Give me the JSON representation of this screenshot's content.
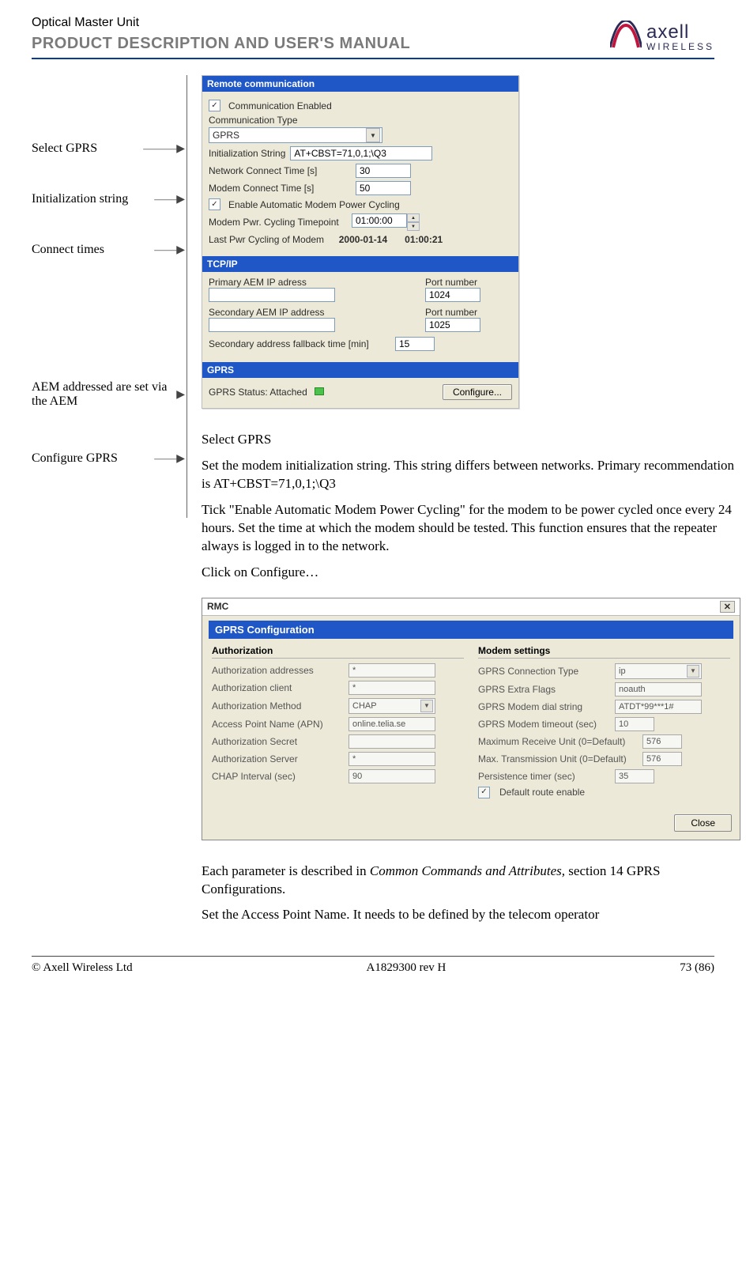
{
  "header": {
    "product": "Optical Master Unit",
    "manual_title": "PRODUCT DESCRIPTION AND USER'S MANUAL",
    "logo_text": "axell",
    "logo_sub": "WIRELESS"
  },
  "callouts": {
    "select_gprs": "Select GPRS",
    "init_string": "Initialization string",
    "connect_times": "Connect times",
    "aem_addresses": "AEM addressed are set via the AEM",
    "configure_gprs": "Configure GPRS"
  },
  "remote": {
    "section_title": "Remote communication",
    "comm_enabled_label": "Communication Enabled",
    "comm_enabled_checked": "✓",
    "comm_type_label": "Communication Type",
    "comm_type_value": "GPRS",
    "init_string_label": "Initialization String",
    "init_string_value": "AT+CBST=71,0,1;\\Q3",
    "net_connect_label": "Network Connect Time [s]",
    "net_connect_value": "30",
    "modem_connect_label": "Modem Connect Time [s]",
    "modem_connect_value": "50",
    "auto_cycle_label": "Enable Automatic Modem Power Cycling",
    "auto_cycle_checked": "✓",
    "cycle_time_label": "Modem Pwr. Cycling Timepoint",
    "cycle_time_value": "01:00:00",
    "last_cycle_label": "Last Pwr Cycling of Modem",
    "last_cycle_date": "2000-01-14",
    "last_cycle_time": "01:00:21"
  },
  "tcpip": {
    "section_title": "TCP/IP",
    "primary_ip_label": "Primary AEM IP adress",
    "primary_port_label": "Port number",
    "primary_port_value": "1024",
    "secondary_ip_label": "Secondary AEM IP address",
    "secondary_port_label": "Port number",
    "secondary_port_value": "1025",
    "fallback_label": "Secondary address fallback time [min]",
    "fallback_value": "15"
  },
  "gprs_bar": {
    "section_title": "GPRS",
    "status_label": "GPRS Status: ",
    "status_value": "Attached",
    "configure_btn": "Configure..."
  },
  "body": {
    "p1": "Select GPRS",
    "p2": "Set the modem initialization string. This string differs between networks. Primary recommendation is AT+CBST=71,0,1;\\Q3",
    "p3": "Tick \"Enable Automatic Modem Power Cycling\" for the modem to be power cycled once every 24 hours. Set the time at which the modem should be tested. This function ensures that the repeater always is logged in to the network.",
    "p4": "Click on Configure…",
    "p5a": "Each parameter is described in ",
    "p5i": "Common Commands and Attributes,",
    "p5b": " section 14 GPRS Configurations.",
    "p6": "Set the Access Point Name. It needs to be defined by the telecom operator"
  },
  "rmc": {
    "window_title": "RMC",
    "panel_title": "GPRS Configuration",
    "auth_head": "Authorization",
    "modem_head": "Modem settings",
    "auth": {
      "addresses_label": "Authorization addresses",
      "addresses_value": "*",
      "client_label": "Authorization client",
      "client_value": "*",
      "method_label": "Authorization Method",
      "method_value": "CHAP",
      "apn_label": "Access Point Name (APN)",
      "apn_value": "online.telia.se",
      "secret_label": "Authorization Secret",
      "secret_value": "",
      "server_label": "Authorization Server",
      "server_value": "*",
      "chap_label": "CHAP Interval (sec)",
      "chap_value": "90"
    },
    "modem": {
      "conn_type_label": "GPRS Connection Type",
      "conn_type_value": "ip",
      "extra_flags_label": "GPRS Extra Flags",
      "extra_flags_value": "noauth",
      "dial_label": "GPRS Modem dial string",
      "dial_value": "ATDT*99***1#",
      "timeout_label": "GPRS Modem timeout (sec)",
      "timeout_value": "10",
      "mru_label": "Maximum Receive Unit (0=Default)",
      "mru_value": "576",
      "mtu_label": "Max. Transmission Unit (0=Default)",
      "mtu_value": "576",
      "persist_label": "Persistence timer (sec)",
      "persist_value": "35",
      "route_label": "Default route enable",
      "route_checked": "✓"
    },
    "close_btn": "Close"
  },
  "footer": {
    "left": "© Axell Wireless Ltd",
    "center": "A1829300 rev H",
    "right": "73 (86)"
  },
  "icons": {
    "caret_down": "▼",
    "spin_up": "▲",
    "spin_down": "▼"
  }
}
